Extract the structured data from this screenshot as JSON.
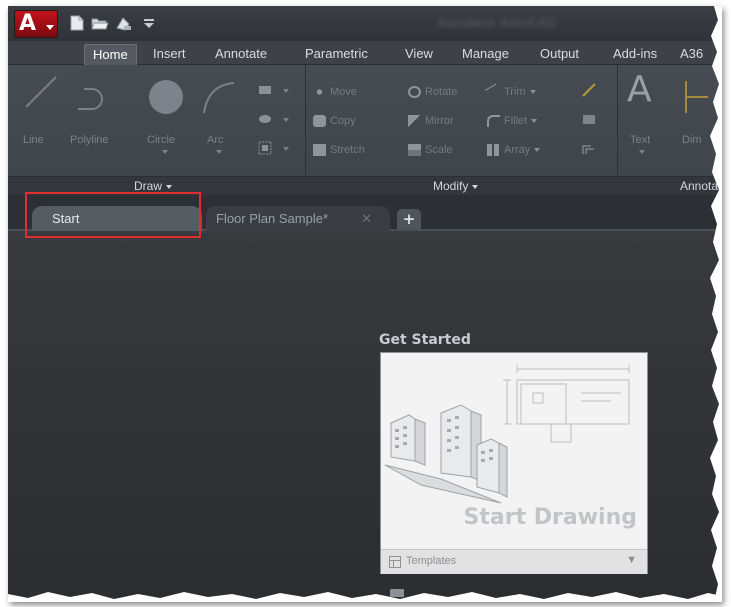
{
  "titlebar": {
    "title": "Autodesk AutoCAD"
  },
  "ribbon": {
    "tabs": [
      {
        "label": "Home",
        "active": true
      },
      {
        "label": "Insert"
      },
      {
        "label": "Annotate"
      },
      {
        "label": "Parametric"
      },
      {
        "label": "View"
      },
      {
        "label": "Manage"
      },
      {
        "label": "Output"
      },
      {
        "label": "Add-ins"
      },
      {
        "label": "A36"
      }
    ],
    "draw_tools": {
      "line": "Line",
      "polyline": "Polyline",
      "circle": "Circle",
      "arc": "Arc"
    },
    "modify_tools": {
      "move": "Move",
      "rotate": "Rotate",
      "trim": "Trim",
      "copy": "Copy",
      "mirror": "Mirror",
      "fillet": "Fillet",
      "stretch": "Stretch",
      "scale": "Scale",
      "array": "Array"
    },
    "annotation_tools": {
      "text": "Text",
      "dim": "Dim"
    },
    "panels": {
      "draw": "Draw",
      "modify": "Modify",
      "annotation": "Annota"
    }
  },
  "doc_tabs": {
    "start": "Start",
    "floor_plan": "Floor Plan Sample*",
    "new": "+"
  },
  "canvas": {
    "get_started": "Get Started",
    "start_drawing": "Start Drawing",
    "templates": "Templates",
    "templates_arrow": "▼"
  },
  "colors": {
    "app_red": "#c4121b",
    "highlight_red": "#e0302e",
    "ribbon_bg": "#474b52",
    "canvas_bg": "#2b2d30"
  }
}
